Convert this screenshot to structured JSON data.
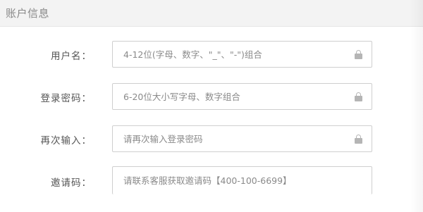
{
  "header": {
    "title": "账户信息"
  },
  "form": {
    "username": {
      "label": "用户名：",
      "placeholder": "4-12位(字母、数字、\"_\"、\"-\")组合",
      "value": "",
      "icon": "lock-icon"
    },
    "password": {
      "label": "登录密码：",
      "placeholder": "6-20位大小写字母、数字组合",
      "value": "",
      "icon": "lock-icon"
    },
    "confirm": {
      "label": "再次输入：",
      "placeholder": "请再次输入登录密码",
      "value": "",
      "icon": "lock-icon"
    },
    "invite": {
      "label": "邀请码：",
      "placeholder": "请联系客服获取邀请码【400-100-6699】",
      "value": ""
    }
  },
  "colors": {
    "border": "#cfcfcf",
    "header_bg": "#f3f3f3",
    "icon": "#b5b5b5"
  }
}
